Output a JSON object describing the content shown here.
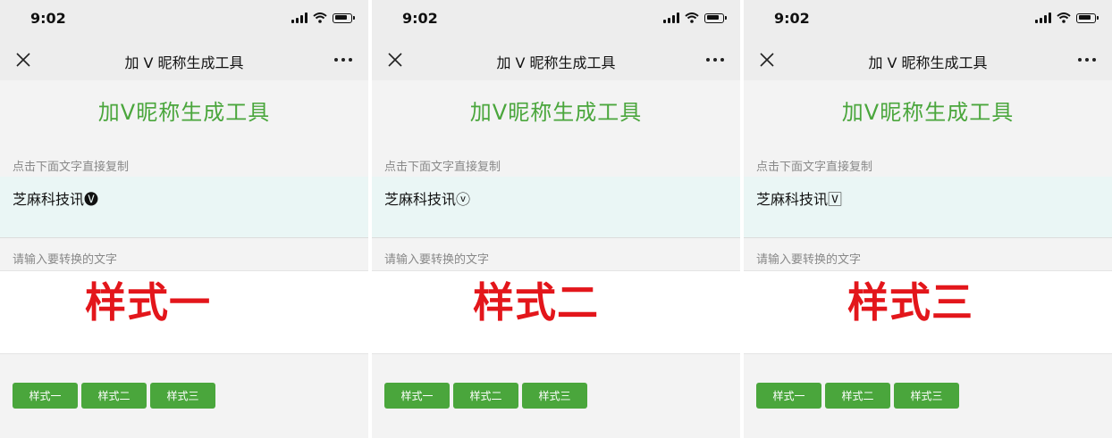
{
  "panels": [
    {
      "status": {
        "time": "9:02"
      },
      "nav": {
        "title": "加 V 昵称生成工具"
      },
      "heading": "加V昵称生成工具",
      "copy_label": "点击下面文字直接复制",
      "result": "芝麻科技讯🅥",
      "input_label": "请输入要转换的文字",
      "caption": "样式一",
      "buttons": [
        "样式一",
        "样式二",
        "样式三"
      ]
    },
    {
      "status": {
        "time": "9:02"
      },
      "nav": {
        "title": "加 V 昵称生成工具"
      },
      "heading": "加V昵称生成工具",
      "copy_label": "点击下面文字直接复制",
      "result": "芝麻科技讯ⓥ",
      "input_label": "请输入要转换的文字",
      "caption": "样式二",
      "buttons": [
        "样式一",
        "样式二",
        "样式三"
      ]
    },
    {
      "status": {
        "time": "9:02"
      },
      "nav": {
        "title": "加 V 昵称生成工具"
      },
      "heading": "加V昵称生成工具",
      "copy_label": "点击下面文字直接复制",
      "result": "芝麻科技讯🅅",
      "input_label": "请输入要转换的文字",
      "caption": "样式三",
      "buttons": [
        "样式一",
        "样式二",
        "样式三"
      ]
    }
  ],
  "colors": {
    "accent": "#4aa63c",
    "caption": "#e3161b",
    "result_bg": "#eaf6f5",
    "bar_bg": "#ededed"
  },
  "icons": [
    "close-icon",
    "more-icon",
    "signal-icon",
    "wifi-icon",
    "battery-icon"
  ]
}
